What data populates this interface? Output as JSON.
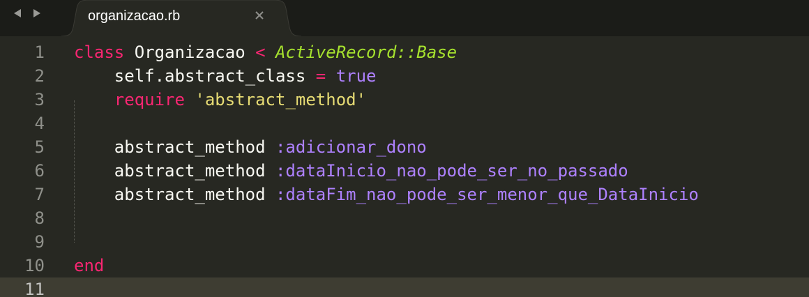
{
  "tab": {
    "title": "organizacao.rb",
    "close_icon": "close-icon"
  },
  "navigation": {
    "back_icon": "triangle-left-icon",
    "forward_icon": "triangle-right-icon"
  },
  "colors": {
    "background": "#272822",
    "tabbar": "#1b1c18",
    "keyword": "#f92672",
    "inherited_class": "#a6e22e",
    "constant": "#ae81ff",
    "string": "#e6db74",
    "current_line": "#3e3d32"
  },
  "editor": {
    "current_line": 11,
    "lines": [
      {
        "number": "1",
        "tokens": [
          {
            "t": "class",
            "c": "kw"
          },
          {
            "t": " ",
            "c": "ident"
          },
          {
            "t": "Organizacao",
            "c": "cls"
          },
          {
            "t": " ",
            "c": "ident"
          },
          {
            "t": "<",
            "c": "op"
          },
          {
            "t": " ",
            "c": "ident"
          },
          {
            "t": "ActiveRecord::Base",
            "c": "inh"
          }
        ]
      },
      {
        "number": "2",
        "tokens": [
          {
            "t": "    self.abstract_class",
            "c": "ident"
          },
          {
            "t": " ",
            "c": "ident"
          },
          {
            "t": "=",
            "c": "op"
          },
          {
            "t": " ",
            "c": "ident"
          },
          {
            "t": "true",
            "c": "const"
          }
        ]
      },
      {
        "number": "3",
        "tokens": [
          {
            "t": "    ",
            "c": "ident"
          },
          {
            "t": "require",
            "c": "kw"
          },
          {
            "t": " ",
            "c": "ident"
          },
          {
            "t": "'abstract_method'",
            "c": "str"
          }
        ]
      },
      {
        "number": "4",
        "tokens": []
      },
      {
        "number": "5",
        "tokens": [
          {
            "t": "    abstract_method ",
            "c": "ident"
          },
          {
            "t": ":adicionar_dono",
            "c": "sym"
          }
        ]
      },
      {
        "number": "6",
        "tokens": [
          {
            "t": "    abstract_method ",
            "c": "ident"
          },
          {
            "t": ":dataInicio_nao_pode_ser_no_passado",
            "c": "sym"
          }
        ]
      },
      {
        "number": "7",
        "tokens": [
          {
            "t": "    abstract_method ",
            "c": "ident"
          },
          {
            "t": ":dataFim_nao_pode_ser_menor_que_DataInicio",
            "c": "sym"
          }
        ]
      },
      {
        "number": "8",
        "tokens": []
      },
      {
        "number": "9",
        "tokens": []
      },
      {
        "number": "10",
        "tokens": [
          {
            "t": "end",
            "c": "kw"
          }
        ]
      },
      {
        "number": "11",
        "tokens": []
      }
    ]
  }
}
